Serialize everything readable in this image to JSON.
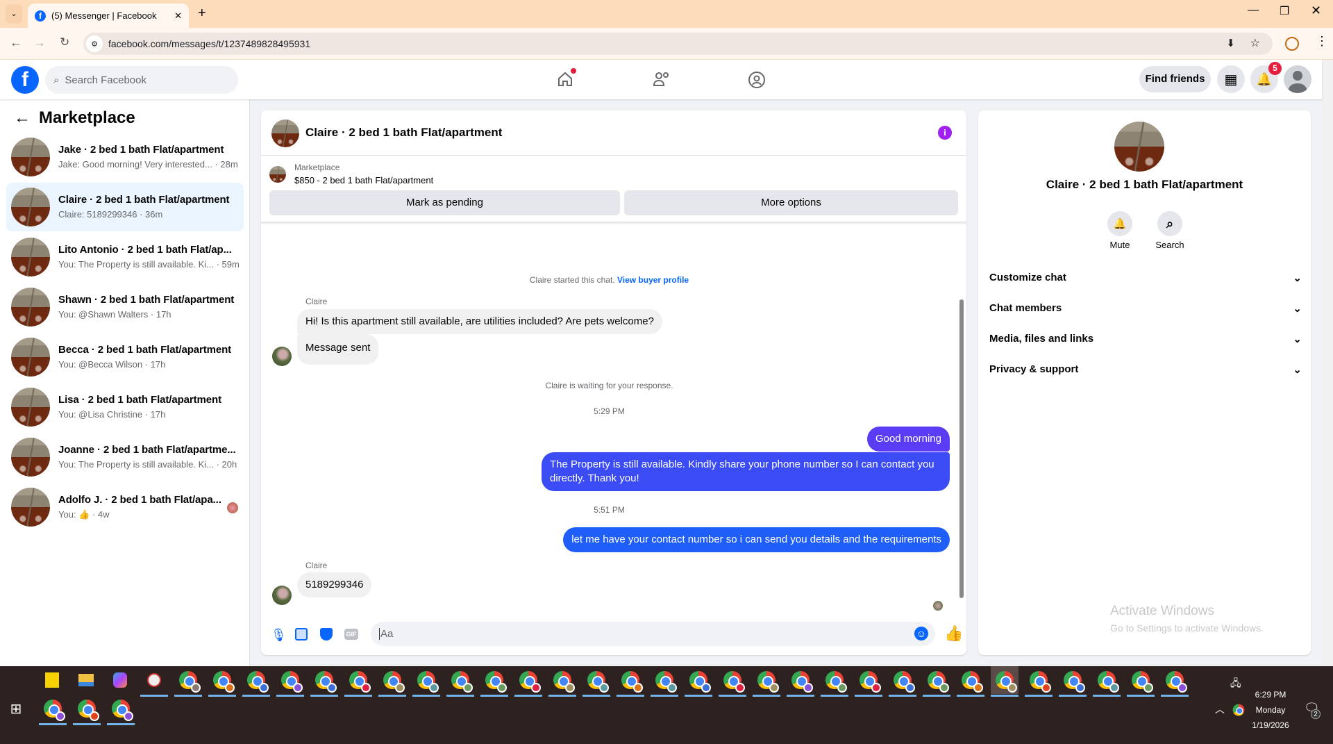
{
  "browser": {
    "tab_title": "(5) Messenger | Facebook",
    "url": "facebook.com/messages/t/1237489828495931"
  },
  "header": {
    "search_placeholder": "Search Facebook",
    "find_friends": "Find friends",
    "notification_count": "5"
  },
  "sidebar": {
    "title": "Marketplace",
    "conversations": [
      {
        "name": "Jake · 2 bed 1 bath Flat/apartment",
        "preview": "Jake: Good morning! Very interested... · 28m"
      },
      {
        "name": "Claire · 2 bed 1 bath Flat/apartment",
        "preview": "Claire: 5189299346 · 36m",
        "selected": true
      },
      {
        "name": "Lito Antonio · 2 bed 1 bath Flat/ap...",
        "preview": "You: The Property is still available. Ki... · 59m"
      },
      {
        "name": "Shawn · 2 bed 1 bath Flat/apartment",
        "preview": "You: @Shawn Walters · 17h"
      },
      {
        "name": "Becca · 2 bed 1 bath Flat/apartment",
        "preview": "You: @Becca Wilson · 17h"
      },
      {
        "name": "Lisa · 2 bed 1 bath Flat/apartment",
        "preview": "You: @Lisa Christine · 17h"
      },
      {
        "name": "Joanne · 2 bed 1 bath Flat/apartme...",
        "preview": "You: The Property is still available. Ki... · 20h"
      },
      {
        "name": "Adolfo J. · 2 bed 1 bath Flat/apa...",
        "preview": "You: 👍 · 4w"
      }
    ]
  },
  "chat": {
    "title": "Claire · 2 bed 1 bath Flat/apartment",
    "listing_label": "Marketplace",
    "listing": "$850 - 2 bed 1 bath Flat/apartment",
    "mark_pending": "Mark as pending",
    "more_options": "More options",
    "started": "Claire started this chat.",
    "view_profile": "View buyer profile",
    "sender": "Claire",
    "msg1": "Hi! Is this apartment still available, are utilities included? Are pets welcome?",
    "msg2": "Message sent",
    "waiting": "Claire is waiting for your response.",
    "time1": "5:29 PM",
    "out1": "Good morning",
    "out2": "The Property is still available. Kindly share your phone number so I can contact you directly. Thank you!",
    "time2": "5:51 PM",
    "out3": "let me have your contact number so i can send you details and the requirements",
    "msg3": "5189299346",
    "composer_placeholder": "Aa"
  },
  "info": {
    "name": "Claire · 2 bed 1 bath Flat/apartment",
    "mute": "Mute",
    "search": "Search",
    "sections": [
      "Customize chat",
      "Chat members",
      "Media, files and links",
      "Privacy & support"
    ]
  },
  "watermark": {
    "title": "Activate Windows",
    "sub": "Go to Settings to activate Windows."
  },
  "taskbar": {
    "time": "6:29 PM",
    "day": "Monday",
    "date": "1/19/2026",
    "notifications": "2",
    "row1_badges": [
      "#8a7a70",
      "#d9731a",
      "#3a6fd8",
      "#8a4fd8",
      "#3a6fd8",
      "#e02040",
      "#a09060",
      "#5a9aa0",
      "#6a9a60",
      "#6a9a60",
      "#e02040",
      "#a09060",
      "#5a9aa0",
      "#d9731a",
      "#5a9aa0",
      "#3a6fd8",
      "#e02040",
      "#a09060",
      "#8a4fd8",
      "#6a9a60",
      "#e02040",
      "#3a6fd8",
      "#6a9a60",
      "#d9731a",
      "#a09060",
      "#e0401a",
      "#3a6fd8",
      "#5a9aa0",
      "#6a9a60",
      "#8a4fd8"
    ],
    "row2_badges": [
      "#8a4fd8",
      "#e0401a",
      "#8a4fd8"
    ]
  },
  "colors": {
    "accent": "#0866ff",
    "outgoing": "#3b4cf5",
    "info": "#a020f0"
  }
}
